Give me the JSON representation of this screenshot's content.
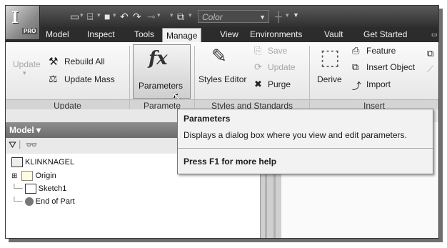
{
  "app": {
    "badge": "PRO"
  },
  "quick_access": {
    "color_field": "Color"
  },
  "menu_tabs": [
    "Model",
    "Inspect",
    "Tools",
    "Manage",
    "View",
    "Environments",
    "Vault",
    "Get Started"
  ],
  "active_tab": "Manage",
  "ribbon": {
    "update_panel": {
      "title": "Update",
      "update_label": "Update",
      "rebuild_all": "Rebuild All",
      "update_mass": "Update Mass"
    },
    "parameters_panel": {
      "title": "Paramete",
      "parameters_label": "Parameters"
    },
    "styles_panel": {
      "title": "Styles and Standards",
      "styles_editor": "Styles Editor",
      "save": "Save",
      "update": "Update",
      "purge": "Purge"
    },
    "insert_panel": {
      "title": "Insert",
      "derive": "Derive",
      "feature": "Feature",
      "insert_object": "Insert Object",
      "import": "Import"
    }
  },
  "tooltip": {
    "title": "Parameters",
    "description": "Displays a dialog box where you view and edit parameters.",
    "help": "Press F1 for more help"
  },
  "browser": {
    "header": "Model ▾",
    "tree": [
      "KLINKNAGEL",
      "Origin",
      "Sketch1",
      "End of Part"
    ]
  },
  "colors": {
    "title_bar": "#3a3a3a",
    "ribbon": "#f1f1f1",
    "tooltip_bg": "#f2f2f2"
  }
}
